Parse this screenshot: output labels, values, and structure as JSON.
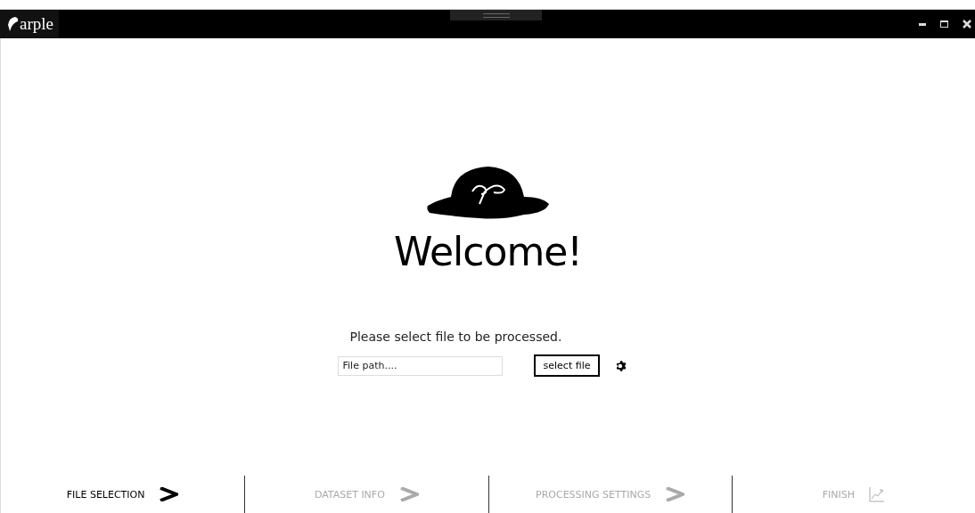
{
  "window": {
    "title": "arple"
  },
  "welcome": "Welcome!",
  "prompt": "Please select file to be processed.",
  "file_field": {
    "placeholder": "File path...."
  },
  "select_button": "select file",
  "steps": [
    {
      "label": "FILE SELECTION",
      "selected": true,
      "kind": "arrow"
    },
    {
      "label": "DATASET INFO",
      "selected": false,
      "kind": "arrow"
    },
    {
      "label": "PROCESSING SETTINGS",
      "selected": false,
      "kind": "arrow"
    },
    {
      "label": "FINISH",
      "selected": false,
      "kind": "chart"
    }
  ]
}
